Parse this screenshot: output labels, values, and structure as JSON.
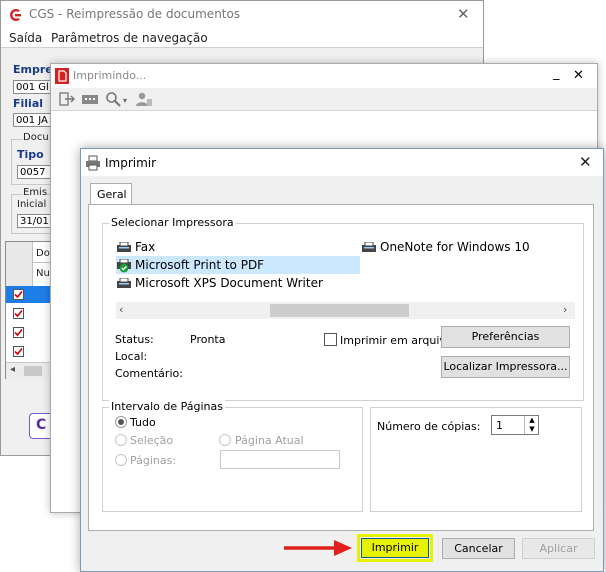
{
  "cgs_window": {
    "title": "CGS - Reimpressão de documentos",
    "menu": [
      "Saída",
      "Parâmetros de navegação"
    ],
    "fragments": {
      "empresa_label": "Empre",
      "empresa_value": "001 Gl",
      "filial_label": "Filial",
      "filial_value": "001 JA",
      "doc_group": "Docu",
      "tipo_label": "Tipo",
      "tipo_value": "0057",
      "emis_group": "Emis",
      "inicial_label": "Inicial",
      "inicial_value": "31/01",
      "grid_header_1": "Do",
      "grid_header_2": "Nu"
    }
  },
  "imprimindo_window": {
    "title": "Imprimindo..."
  },
  "print_dialog": {
    "title": "Imprimir",
    "tab": "Geral",
    "select_printer_legend": "Selecionar Impressora",
    "printers": [
      {
        "name": "Fax",
        "icon": "fax-printer-icon"
      },
      {
        "name": "Microsoft Print to PDF",
        "icon": "default-printer-icon",
        "selected": true
      },
      {
        "name": "Microsoft XPS Document Writer",
        "icon": "printer-icon"
      },
      {
        "name": "OneNote for Windows 10",
        "icon": "printer-icon"
      }
    ],
    "status_label": "Status:",
    "status_value": "Pronta",
    "local_label": "Local:",
    "comment_label": "Comentário:",
    "print_to_file_label": "Imprimir em arquivo",
    "print_to_file_checked": false,
    "preferences_button": "Preferências",
    "find_printer_button": "Localizar Impressora...",
    "page_range_legend": "Intervalo de Páginas",
    "range_all": "Tudo",
    "range_selection": "Seleção",
    "range_current": "Página Atual",
    "range_pages": "Páginas:",
    "pages_value": "",
    "copies_label": "Número de cópias:",
    "copies_value": "1",
    "print_button": "Imprimir",
    "cancel_button": "Cancelar",
    "apply_button": "Aplicar",
    "highlight_color": "#e6f200",
    "arrow_color": "#e0201c",
    "selection_color": "#cce8ff"
  }
}
